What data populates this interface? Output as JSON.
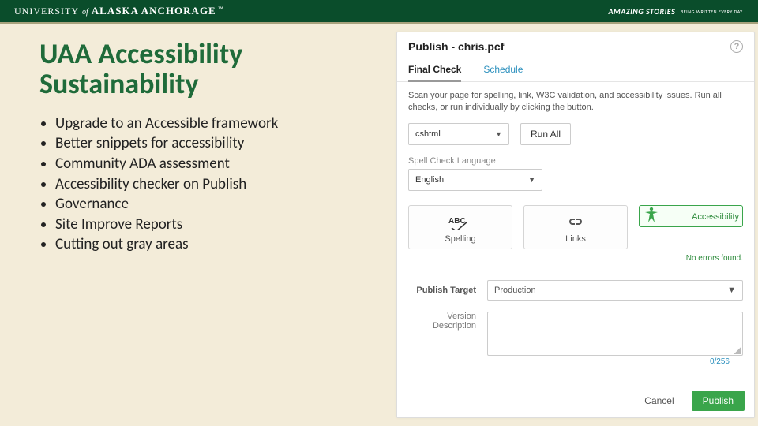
{
  "header": {
    "logo": {
      "part1": "UNIVERSITY",
      "part2": "of",
      "part3": "ALASKA ANCHORAGE",
      "tm": "™"
    },
    "tagline": {
      "main": "AMAZING STORIES",
      "sub": "BEING WRITTEN\nEVERY DAY."
    }
  },
  "slide": {
    "title": "UAA Accessibility Sustainability",
    "bullets": [
      "Upgrade to an Accessible framework",
      "Better snippets for accessibility",
      "Community ADA assessment",
      "Accessibility checker on Publish",
      "Governance",
      "Site Improve Reports",
      "Cutting out gray areas"
    ]
  },
  "dialog": {
    "title": "Publish - chris.pcf",
    "tabs": [
      {
        "label": "Final Check",
        "active": true
      },
      {
        "label": "Schedule",
        "active": false
      }
    ],
    "instructions": "Scan your page for spelling, link, W3C validation, and accessibility issues. Run all checks, or run individually by clicking the button.",
    "format_select": {
      "value": "cshtml"
    },
    "run_all_label": "Run All",
    "spellcheck": {
      "label": "Spell Check Language",
      "value": "English"
    },
    "checks": [
      {
        "id": "spelling",
        "label": "Spelling",
        "selected": false
      },
      {
        "id": "links",
        "label": "Links",
        "selected": false
      },
      {
        "id": "accessibility",
        "label": "Accessibility",
        "selected": true
      }
    ],
    "no_errors": "No errors found.",
    "publish_target": {
      "label": "Publish Target",
      "value": "Production"
    },
    "version_desc": {
      "label": "Version Description",
      "counter": "0/256"
    },
    "footer": {
      "cancel": "Cancel",
      "publish": "Publish"
    }
  }
}
